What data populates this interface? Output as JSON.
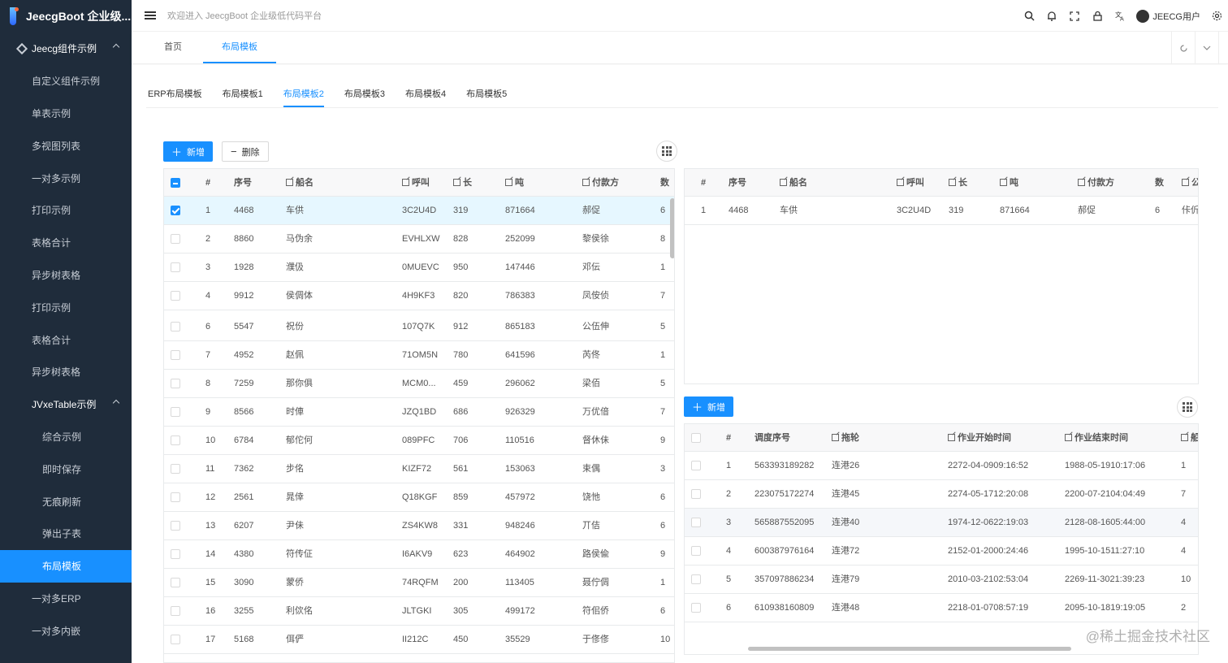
{
  "app": {
    "title": "JeecgBoot 企业级..."
  },
  "header": {
    "welcome": "欢迎进入 JeecgBoot 企业级低代码平台",
    "username": "JEECG用户"
  },
  "sidebar": {
    "items": [
      {
        "label": "Jeecg组件示例",
        "level": 0,
        "parent": true
      },
      {
        "label": "自定义组件示例",
        "level": 1
      },
      {
        "label": "单表示例",
        "level": 1
      },
      {
        "label": "多视图列表",
        "level": 1
      },
      {
        "label": "一对多示例",
        "level": 1
      },
      {
        "label": "打印示例",
        "level": 1
      },
      {
        "label": "表格合计",
        "level": 1
      },
      {
        "label": "异步树表格",
        "level": 1
      },
      {
        "label": "打印示例",
        "level": 1
      },
      {
        "label": "表格合计",
        "level": 1
      },
      {
        "label": "异步树表格",
        "level": 1
      },
      {
        "label": "JVxeTable示例",
        "level": 1,
        "parent": true
      },
      {
        "label": "综合示例",
        "level": 2
      },
      {
        "label": "即时保存",
        "level": 2
      },
      {
        "label": "无痕刷新",
        "level": 2
      },
      {
        "label": "弹出子表",
        "level": 2
      },
      {
        "label": "布局模板",
        "level": 2,
        "active": true
      },
      {
        "label": "一对多ERP",
        "level": 1
      },
      {
        "label": "一对多内嵌",
        "level": 1
      }
    ]
  },
  "page_tabs": [
    {
      "label": "首页",
      "active": false
    },
    {
      "label": "布局模板",
      "active": true
    }
  ],
  "sub_tabs": [
    {
      "label": "ERP布局模板",
      "active": false
    },
    {
      "label": "布局模板1",
      "active": false
    },
    {
      "label": "布局模板2",
      "active": true
    },
    {
      "label": "布局模板3",
      "active": false
    },
    {
      "label": "布局模板4",
      "active": false
    },
    {
      "label": "布局模板5",
      "active": false
    }
  ],
  "toolbar": {
    "add_label": "新增",
    "delete_label": "删除",
    "add_label_bottom": "新增"
  },
  "main_table": {
    "columns": [
      "#",
      "序号",
      "船名",
      "呼叫",
      "长",
      "吨",
      "付款方",
      "数"
    ],
    "rows": [
      {
        "idx": "1",
        "seq": "4468",
        "ship": "车供",
        "call": "3C2U4D",
        "len": "319",
        "ton": "871664",
        "payer": "郝促",
        "num": "6",
        "checked": true
      },
      {
        "idx": "2",
        "seq": "8860",
        "ship": "马伪余",
        "call": "EVHLXW",
        "len": "828",
        "ton": "252099",
        "payer": "黎侯徐",
        "num": "8"
      },
      {
        "idx": "3",
        "seq": "1928",
        "ship": "濮伋",
        "call": "0MUEVC",
        "len": "950",
        "ton": "147446",
        "payer": "邓伝",
        "num": "1"
      },
      {
        "idx": "4",
        "seq": "9912",
        "ship": "侯倜体",
        "call": "4H9KF3",
        "len": "820",
        "ton": "786383",
        "payer": "凤侒侦",
        "num": "7"
      },
      {
        "idx": "6",
        "seq": "5547",
        "ship": "祝份",
        "call": "107Q7K",
        "len": "912",
        "ton": "865183",
        "payer": "公伍伸",
        "num": "5"
      },
      {
        "idx": "7",
        "seq": "4952",
        "ship": "赵佩",
        "call": "71OM5N",
        "len": "780",
        "ton": "641596",
        "payer": "芮佟",
        "num": "1"
      },
      {
        "idx": "8",
        "seq": "7259",
        "ship": "那你俱",
        "call": "MCM0...",
        "len": "459",
        "ton": "296062",
        "payer": "梁佰",
        "num": "5"
      },
      {
        "idx": "9",
        "seq": "8566",
        "ship": "时俥",
        "call": "JZQ1BD",
        "len": "686",
        "ton": "926329",
        "payer": "万优偣",
        "num": "7"
      },
      {
        "idx": "10",
        "seq": "6784",
        "ship": "郁佗何",
        "call": "089PFC",
        "len": "706",
        "ton": "110516",
        "payer": "督休佅",
        "num": "9"
      },
      {
        "idx": "11",
        "seq": "7362",
        "ship": "步佲",
        "call": "KIZF72",
        "len": "561",
        "ton": "153063",
        "payer": "束偶",
        "num": "3"
      },
      {
        "idx": "12",
        "seq": "2561",
        "ship": "晁倖",
        "call": "Q18KGF",
        "len": "859",
        "ton": "457972",
        "payer": "饶忚",
        "num": "6"
      },
      {
        "idx": "13",
        "seq": "6207",
        "ship": "尹佅",
        "call": "ZS4KW8",
        "len": "331",
        "ton": "948246",
        "payer": "丌佶",
        "num": "6"
      },
      {
        "idx": "14",
        "seq": "4380",
        "ship": "符传佂",
        "call": "I6AKV9",
        "len": "623",
        "ton": "464902",
        "payer": "路侯偸",
        "num": "9"
      },
      {
        "idx": "15",
        "seq": "3090",
        "ship": "蒙侨",
        "call": "74RQFM",
        "len": "200",
        "ton": "113405",
        "payer": "聂佇倜",
        "num": "1"
      },
      {
        "idx": "16",
        "seq": "3255",
        "ship": "利佽佲",
        "call": "JLTGKI",
        "len": "305",
        "ton": "499172",
        "payer": "符佀侨",
        "num": "6"
      },
      {
        "idx": "17",
        "seq": "5168",
        "ship": "佴俨",
        "call": "II212C",
        "len": "450",
        "ton": "35529",
        "payer": "于俢俢",
        "num": "10"
      }
    ]
  },
  "detail_table": {
    "columns": [
      "#",
      "序号",
      "船名",
      "呼叫",
      "长",
      "吨",
      "付款方",
      "数",
      "公"
    ],
    "rows": [
      {
        "idx": "1",
        "seq": "4468",
        "ship": "车供",
        "call": "3C2U4D",
        "len": "319",
        "ton": "871664",
        "payer": "郝促",
        "num": "6",
        "extra": "佧伒"
      }
    ]
  },
  "dispatch_table": {
    "columns": [
      "#",
      "调度序号",
      "拖轮",
      "作业开始时间",
      "作业结束时间",
      "船"
    ],
    "rows": [
      {
        "idx": "1",
        "dispatch_no": "563393189282",
        "tug": "连港26",
        "start": "2272-04-0909:16:52",
        "end": "1988-05-1910:17:06",
        "num": "1"
      },
      {
        "idx": "2",
        "dispatch_no": "223075172274",
        "tug": "连港45",
        "start": "2274-05-1712:20:08",
        "end": "2200-07-2104:04:49",
        "num": "7"
      },
      {
        "idx": "3",
        "dispatch_no": "565887552095",
        "tug": "连港40",
        "start": "1974-12-0622:19:03",
        "end": "2128-08-1605:44:00",
        "num": "4",
        "hover": true
      },
      {
        "idx": "4",
        "dispatch_no": "600387976164",
        "tug": "连港72",
        "start": "2152-01-2000:24:46",
        "end": "1995-10-1511:27:10",
        "num": "4"
      },
      {
        "idx": "5",
        "dispatch_no": "357097886234",
        "tug": "连港79",
        "start": "2010-03-2102:53:04",
        "end": "2269-11-3021:39:23",
        "num": "10"
      },
      {
        "idx": "6",
        "dispatch_no": "610938160809",
        "tug": "连港48",
        "start": "2218-01-0708:57:19",
        "end": "2095-10-1819:19:05",
        "num": "2"
      }
    ]
  },
  "watermark": "@稀土掘金技术社区",
  "colors": {
    "sidebar_bg": "#1f2c3b",
    "accent": "#1890ff",
    "selected_row": "#e6f7ff"
  }
}
